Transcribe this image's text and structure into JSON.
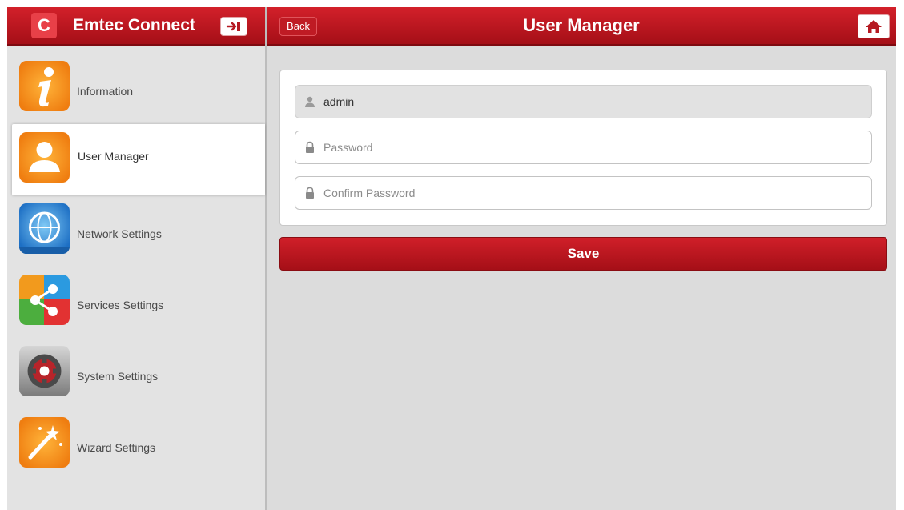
{
  "app": {
    "title": "Emtec Connect",
    "logo_letter": "C",
    "exit_icon": "exit-icon",
    "brand_color": "#c41922"
  },
  "header": {
    "back_label": "Back",
    "title": "User Manager",
    "home_icon": "home-icon"
  },
  "sidebar": {
    "items": [
      {
        "label": "Information",
        "icon": "info-icon",
        "active": false
      },
      {
        "label": "User Manager",
        "icon": "user-icon",
        "active": true
      },
      {
        "label": "Network Settings",
        "icon": "globe-icon",
        "active": false
      },
      {
        "label": "Services Settings",
        "icon": "share-icon",
        "active": false
      },
      {
        "label": "System Settings",
        "icon": "gear-icon",
        "active": false
      },
      {
        "label": "Wizard Settings",
        "icon": "magic-wand-icon",
        "active": false
      }
    ]
  },
  "form": {
    "username": {
      "value": "admin",
      "icon": "user-icon"
    },
    "password": {
      "value": "",
      "placeholder": "Password",
      "icon": "lock-icon"
    },
    "confirm_password": {
      "value": "",
      "placeholder": "Confirm Password",
      "icon": "lock-icon"
    },
    "save_label": "Save"
  }
}
